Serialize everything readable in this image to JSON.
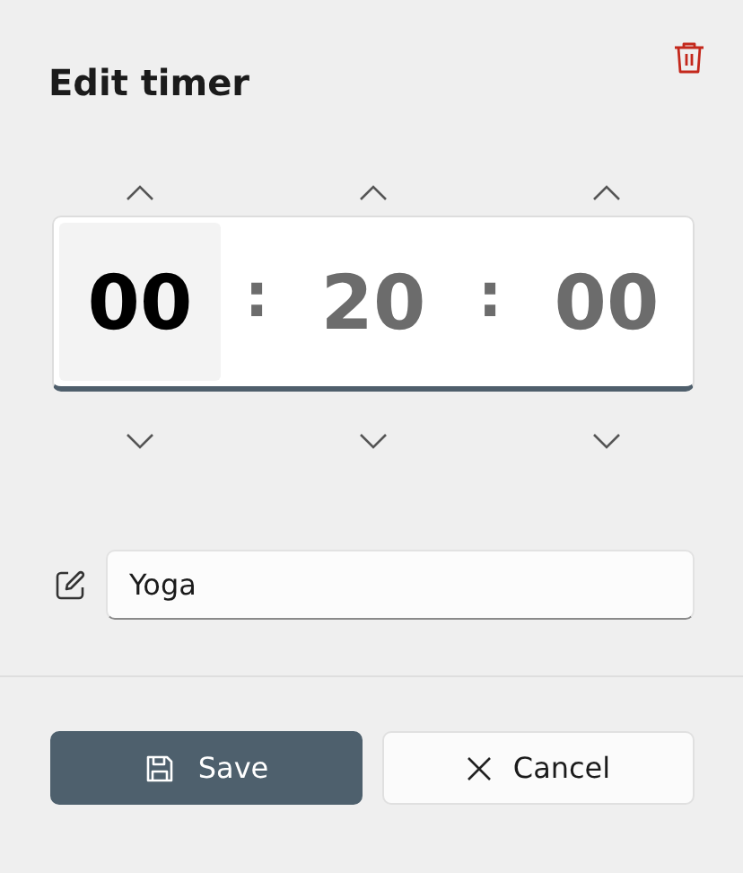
{
  "title": "Edit timer",
  "segments": [
    {
      "value": "00",
      "selected": true
    },
    {
      "value": "20",
      "selected": false
    },
    {
      "value": "00",
      "selected": false
    }
  ],
  "separators": [
    ":",
    ":"
  ],
  "name_field": {
    "value": "Yoga"
  },
  "buttons": [
    {
      "label": "Save",
      "kind": "primary"
    },
    {
      "label": "Cancel",
      "kind": "secondary"
    }
  ]
}
